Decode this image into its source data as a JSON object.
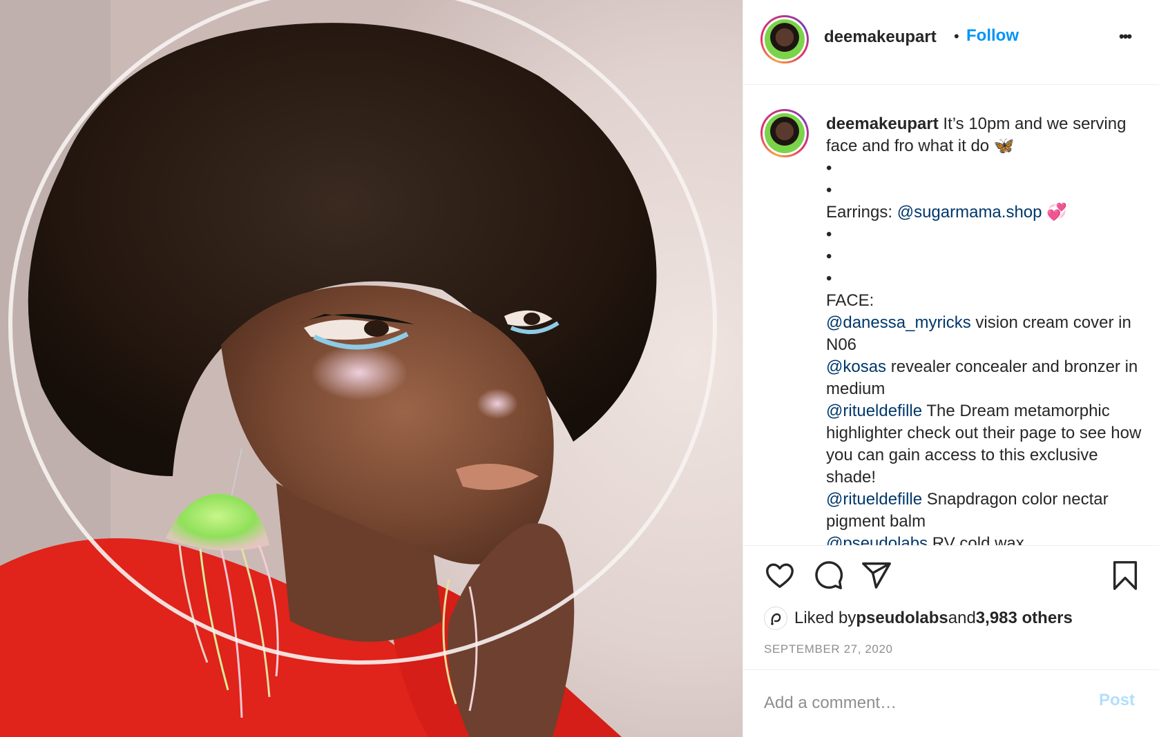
{
  "post": {
    "author": "deemakeupart",
    "follow_label": "Follow",
    "more_label": "•••",
    "dot": "•"
  },
  "caption": {
    "author": "deemakeupart",
    "lines": [
      {
        "mention": "",
        "text": " It’s 10pm and we serving face and fro what it do 🦋"
      },
      {
        "mention": "",
        "text": "•"
      },
      {
        "mention": "",
        "text": "•"
      },
      {
        "mention": "@sugarmama.shop",
        "prefix": "Earrings: ",
        "text": " 💞"
      },
      {
        "mention": "",
        "text": "•"
      },
      {
        "mention": "",
        "text": "•"
      },
      {
        "mention": "",
        "text": "•"
      },
      {
        "mention": "",
        "text": "FACE:"
      },
      {
        "mention": "@danessa_myricks",
        "text": " vision cream cover in N06"
      },
      {
        "mention": "@kosas",
        "text": " revealer concealer and bronzer in medium"
      },
      {
        "mention": "@ritueldefille",
        "text": " The Dream metamorphic highlighter check out their page to see how you can gain access to this exclusive shade!"
      },
      {
        "mention": "@ritueldefille",
        "text": " Snapdragon color nectar pigment balm"
      },
      {
        "mention": "@pseudolabs",
        "text": " RV cold wax"
      }
    ]
  },
  "actions": {
    "like_icon": "heart-icon",
    "comment_icon": "comment-icon",
    "share_icon": "paper-plane-icon",
    "save_icon": "bookmark-icon"
  },
  "likes": {
    "prefix": "Liked by ",
    "user": "pseudolabs",
    "middle": " and ",
    "others": "3,983 others"
  },
  "date": "SEPTEMBER 27, 2020",
  "comment": {
    "placeholder": "Add a comment…",
    "post_label": "Post"
  },
  "colors": {
    "link": "#0095f6",
    "mention": "#00376b",
    "post_disabled": "#b2dffc"
  }
}
